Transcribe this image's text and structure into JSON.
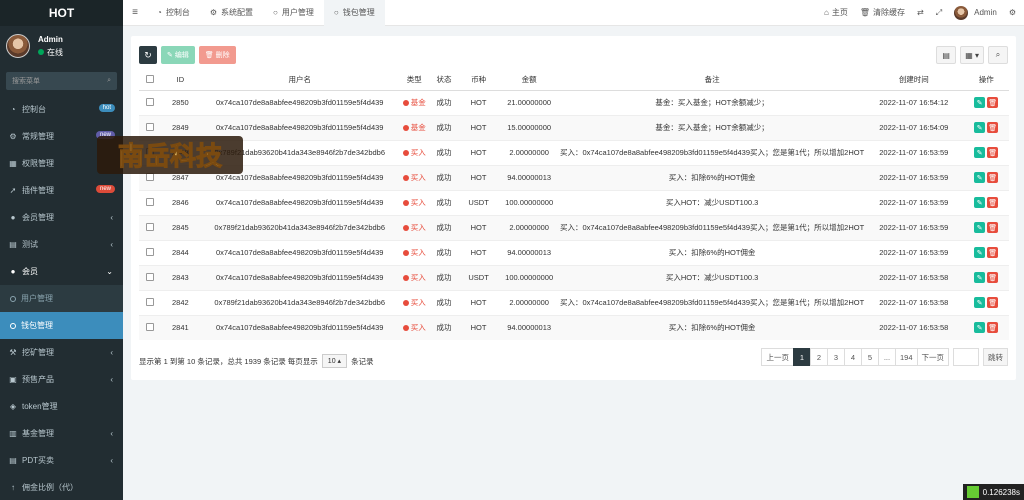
{
  "sidebar": {
    "logo": "HOT",
    "user_name": "Admin",
    "status": "在线",
    "search_placeholder": "搜索菜单",
    "items": [
      {
        "label": "控制台",
        "icon": "dashboard-icon",
        "badge": "hot",
        "badge_color": "#3c8dbc"
      },
      {
        "label": "常规管理",
        "icon": "cog-icon",
        "badge": "new",
        "badge_color": "#605ca8"
      },
      {
        "label": "权限管理",
        "icon": "group-icon"
      },
      {
        "label": "插件管理",
        "icon": "rocket-icon",
        "badge": "new",
        "badge_color": "#dd4b39"
      },
      {
        "label": "会员管理",
        "icon": "user-icon",
        "arrow": "‹"
      },
      {
        "label": "测试",
        "icon": "test-icon",
        "arrow": "‹"
      },
      {
        "label": "会员",
        "icon": "member-icon",
        "arrow": "⌄"
      }
    ],
    "sub_items": [
      {
        "label": "用户管理"
      },
      {
        "label": "钱包管理"
      }
    ],
    "items_after": [
      {
        "label": "挖矿管理",
        "icon": "mining-icon",
        "arrow": "‹"
      },
      {
        "label": "预售产品",
        "icon": "presale-icon",
        "arrow": "‹"
      },
      {
        "label": "token管理",
        "icon": "token-icon"
      },
      {
        "label": "基金管理",
        "icon": "fund-icon",
        "arrow": "‹"
      },
      {
        "label": "PDT买卖",
        "icon": "trade-icon",
        "arrow": "‹"
      },
      {
        "label": "佣金比例（代）",
        "icon": "commission-icon"
      }
    ]
  },
  "topbar": {
    "tabs": [
      {
        "label": "控制台"
      },
      {
        "label": "系统配置"
      },
      {
        "label": "用户管理"
      },
      {
        "label": "钱包管理"
      }
    ],
    "home": "主页",
    "clear_cache": "清除缓存",
    "user": "Admin"
  },
  "toolbar": {
    "edit": "编辑",
    "delete": "删除"
  },
  "table": {
    "headers": [
      "ID",
      "用户名",
      "类型",
      "状态",
      "币种",
      "金额",
      "备注",
      "创建时间",
      "操作"
    ],
    "rows": [
      {
        "id": "2850",
        "user": "0x74ca107de8a8abfee498209b3fd01159e5f4d439",
        "type": "基金",
        "status": "成功",
        "coin": "HOT",
        "amount": "21.00000000",
        "note": "基金：买入基金；HOT余额减少；",
        "time": "2022-11-07 16:54:12"
      },
      {
        "id": "2849",
        "user": "0x74ca107de8a8abfee498209b3fd01159e5f4d439",
        "type": "基金",
        "status": "成功",
        "coin": "HOT",
        "amount": "15.00000000",
        "note": "基金：买入基金；HOT余额减少；",
        "time": "2022-11-07 16:54:09"
      },
      {
        "id": "2848",
        "user": "0x789f21dab93620b41da343e8946f2b7de342bdb6",
        "type": "买入",
        "status": "成功",
        "coin": "HOT",
        "amount": "2.00000000",
        "note": "买入：0x74ca107de8a8abfee498209b3fd01159e5f4d439买入；您是第1代；所以增加2HOT",
        "time": "2022-11-07 16:53:59"
      },
      {
        "id": "2847",
        "user": "0x74ca107de8a8abfee498209b3fd01159e5f4d439",
        "type": "买入",
        "status": "成功",
        "coin": "HOT",
        "amount": "94.00000013",
        "note": "买入：扣除6%的HOT佣金",
        "time": "2022-11-07 16:53:59"
      },
      {
        "id": "2846",
        "user": "0x74ca107de8a8abfee498209b3fd01159e5f4d439",
        "type": "买入",
        "status": "成功",
        "coin": "USDT",
        "amount": "100.00000000",
        "note": "买入HOT：减少USDT100.3",
        "time": "2022-11-07 16:53:59"
      },
      {
        "id": "2845",
        "user": "0x789f21dab93620b41da343e8946f2b7de342bdb6",
        "type": "买入",
        "status": "成功",
        "coin": "HOT",
        "amount": "2.00000000",
        "note": "买入：0x74ca107de8a8abfee498209b3fd01159e5f4d439买入；您是第1代；所以增加2HOT",
        "time": "2022-11-07 16:53:59"
      },
      {
        "id": "2844",
        "user": "0x74ca107de8a8abfee498209b3fd01159e5f4d439",
        "type": "买入",
        "status": "成功",
        "coin": "HOT",
        "amount": "94.00000013",
        "note": "买入：扣除6%的HOT佣金",
        "time": "2022-11-07 16:53:59"
      },
      {
        "id": "2843",
        "user": "0x74ca107de8a8abfee498209b3fd01159e5f4d439",
        "type": "买入",
        "status": "成功",
        "coin": "USDT",
        "amount": "100.00000000",
        "note": "买入HOT：减少USDT100.3",
        "time": "2022-11-07 16:53:58"
      },
      {
        "id": "2842",
        "user": "0x789f21dab93620b41da343e8946f2b7de342bdb6",
        "type": "买入",
        "status": "成功",
        "coin": "HOT",
        "amount": "2.00000000",
        "note": "买入：0x74ca107de8a8abfee498209b3fd01159e5f4d439买入；您是第1代；所以增加2HOT",
        "time": "2022-11-07 16:53:58"
      },
      {
        "id": "2841",
        "user": "0x74ca107de8a8abfee498209b3fd01159e5f4d439",
        "type": "买入",
        "status": "成功",
        "coin": "HOT",
        "amount": "94.00000013",
        "note": "买入：扣除6%的HOT佣金",
        "time": "2022-11-07 16:53:58"
      }
    ]
  },
  "pager": {
    "info_prefix": "显示第 1 到第 10 条记录，总共 1939 条记录 每页显示",
    "page_size": "10",
    "info_suffix": "条记录",
    "prev": "上一页",
    "pages": [
      "1",
      "2",
      "3",
      "4",
      "5",
      "...",
      "194"
    ],
    "next": "下一页",
    "jump": "跳转"
  },
  "watermark": "南岳科技",
  "timer": "0.126238s"
}
